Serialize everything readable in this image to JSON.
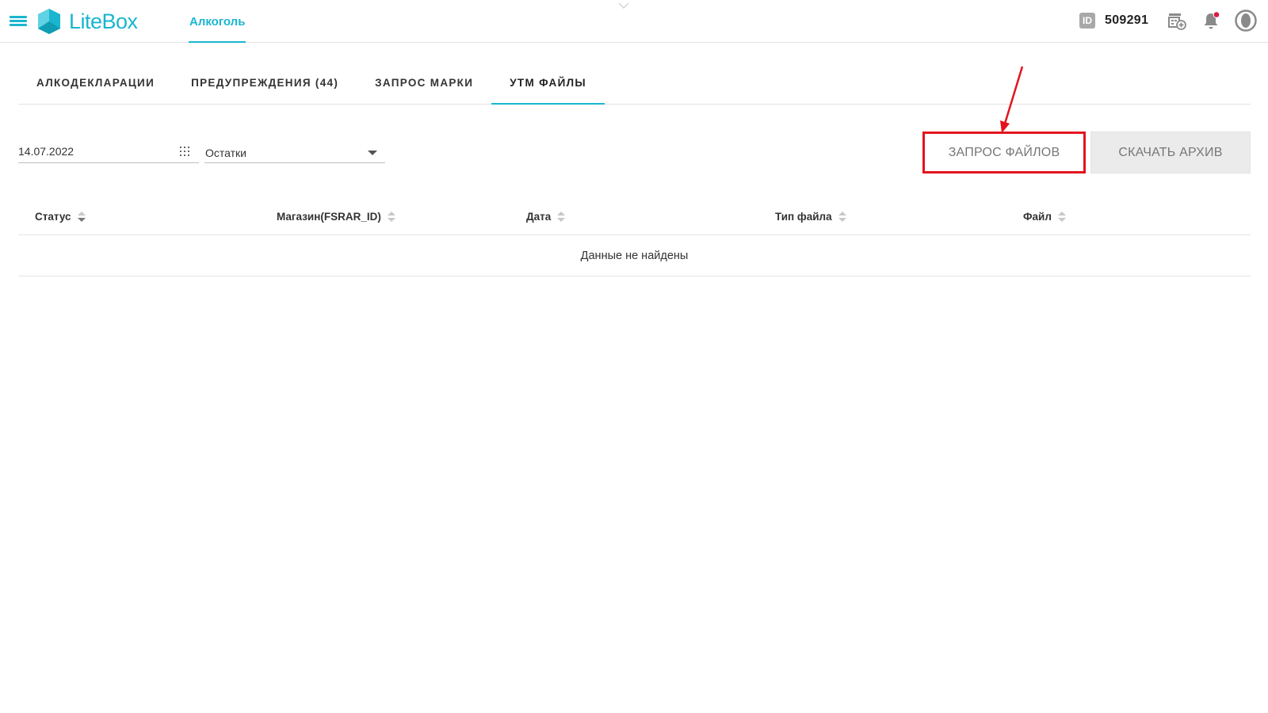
{
  "header": {
    "logo_text": "LiteBox",
    "nav_active": "Алкоголь",
    "account_id": "509291",
    "id_badge": "ID"
  },
  "tabs": [
    {
      "label": "АЛКОДЕКЛАРАЦИИ",
      "active": false
    },
    {
      "label": "ПРЕДУПРЕЖДЕНИЯ (44)",
      "active": false
    },
    {
      "label": "ЗАПРОС МАРКИ",
      "active": false
    },
    {
      "label": "УТМ ФАЙЛЫ",
      "active": true
    }
  ],
  "filters": {
    "date": "14.07.2022",
    "type_selected": "Остатки"
  },
  "buttons": {
    "request_files": "ЗАПРОС ФАЙЛОВ",
    "download_archive": "СКАЧАТЬ АРХИВ"
  },
  "table": {
    "columns": [
      "Статус",
      "Магазин(FSRAR_ID)",
      "Дата",
      "Тип файла",
      "Файл"
    ],
    "empty_message": "Данные не найдены"
  },
  "colors": {
    "accent": "#1ab6cf",
    "highlight": "#e3141e",
    "notification_dot": "#d81b45"
  },
  "icons": [
    "menu-icon",
    "litebox-logo-icon",
    "chevron-down-icon",
    "id-icon",
    "cash-register-add-icon",
    "bell-icon",
    "user-avatar-icon",
    "calendar-grid-icon",
    "dropdown-caret-icon",
    "sort-icon"
  ]
}
